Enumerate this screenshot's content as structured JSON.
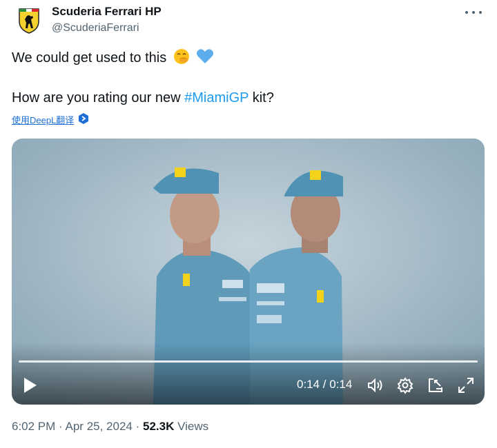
{
  "author": {
    "display_name": "Scuderia Ferrari HP",
    "handle": "@ScuderiaFerrari",
    "avatar_icon": "ferrari-shield-logo"
  },
  "tweet": {
    "line1_text": "We could get used to this",
    "line1_emojis": [
      "face-with-hand-over-mouth-emoji",
      "blue-heart-emoji"
    ],
    "line2_before": "How are you rating our new ",
    "line2_hashtag": "#MiamiGP",
    "line2_after": " kit?",
    "translate_label": "使用DeepL翻译",
    "translate_icon": "deepl-icon"
  },
  "video": {
    "time_display": "0:14 / 0:14",
    "progress": 1.0,
    "controls": [
      "play-icon",
      "volume-icon",
      "settings-gear-icon",
      "picture-in-picture-icon",
      "fullscreen-icon"
    ]
  },
  "meta": {
    "time": "6:02 PM",
    "separator": "·",
    "date": "Apr 25, 2024",
    "views_count": "52.3K",
    "views_label": "Views"
  },
  "colors": {
    "link": "#1d9bf0",
    "secondary_text": "#536471",
    "primary_text": "#0f1419",
    "suit": "#6fa7c6"
  }
}
